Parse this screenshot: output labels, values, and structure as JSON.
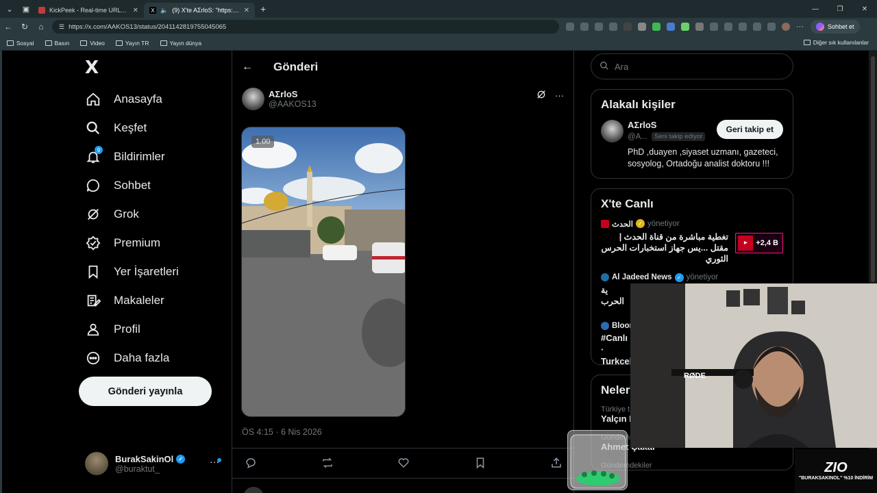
{
  "browser": {
    "tabs": [
      {
        "title": "KickPeek - Real-time URL Crawler",
        "fav_color": "#c23b3b"
      },
      {
        "title": "(9) X'te AΣrloS: \"https://t.co/...",
        "fav_color": "#ffffff"
      }
    ],
    "url": "https://x.com/AAKOS13/status/2041142819755045065",
    "chat_label": "Sohbet et",
    "bookmarks": [
      "Sosyal",
      "Basın",
      "Video",
      "Yayın TR",
      "Yayın dünya"
    ],
    "bookmarks_right": "Diğer sık kullanılanlar"
  },
  "sidebar": {
    "logo": "X",
    "items": [
      {
        "label": "Anasayfa",
        "icon": "home-icon"
      },
      {
        "label": "Keşfet",
        "icon": "search-icon"
      },
      {
        "label": "Bildirimler",
        "icon": "bell-icon",
        "badge": "9"
      },
      {
        "label": "Sohbet",
        "icon": "chat-icon"
      },
      {
        "label": "Grok",
        "icon": "grok-icon"
      },
      {
        "label": "Premium",
        "icon": "premium-icon"
      },
      {
        "label": "Yer İşaretleri",
        "icon": "bookmark-icon"
      },
      {
        "label": "Makaleler",
        "icon": "articles-icon"
      },
      {
        "label": "Profil",
        "icon": "profile-icon"
      },
      {
        "label": "Daha fazla",
        "icon": "more-icon"
      }
    ],
    "post_button": "Gönderi yayınla",
    "me": {
      "name": "BurakSakinOl",
      "handle": "@buraktut_"
    }
  },
  "main": {
    "title": "Gönderi",
    "author": {
      "name": "AΣrloS",
      "handle": "@AAKOS13"
    },
    "video_speed": "1.00",
    "timestamp": "ÖS 4:15 · 6 Nis 2026"
  },
  "right": {
    "search_placeholder": "Ara",
    "related": {
      "title": "Alakalı kişiler",
      "name": "AΣrloS",
      "handle": "@A...",
      "follows_you": "Seni takip ediyor",
      "follow_back": "Geri takip et",
      "bio": "PhD ,duayen ,siyaset uzmanı, gazeteci, sosyolog, Ortadoğu analist doktoru !!!"
    },
    "live": {
      "title": "X'te Canlı",
      "items": [
        {
          "source": "الحدث",
          "role": "yönetiyor",
          "text": "تغطية مباشرة من قناة الحدث | مقتل ...يس جهاز استخبارات الحرس الثوري",
          "count": "+2,4 B",
          "color": "#c5001f"
        },
        {
          "source": "Al Jadeed News",
          "role": "yönetiyor",
          "text": "ية الحرب",
          "color": "#1d6fa5"
        },
        {
          "source": "Bloom",
          "text": "#Canlı · Turkcel",
          "color": "#2b6cb0"
        }
      ]
    },
    "whats_happening": {
      "title": "Neler",
      "t1_small": "Türkiye t",
      "t1_big": "Yalçın K",
      "t2_small": "Gündemdekiler",
      "t2_big": "Ahmet Çakar",
      "t3_small": "Gündemdekiler"
    }
  },
  "overlay": {
    "promo_logo": "ZIO",
    "promo_text": "\"BURAKSAKINOL\" %10 İNDİRİM",
    "mic_brand": "RØDE"
  }
}
